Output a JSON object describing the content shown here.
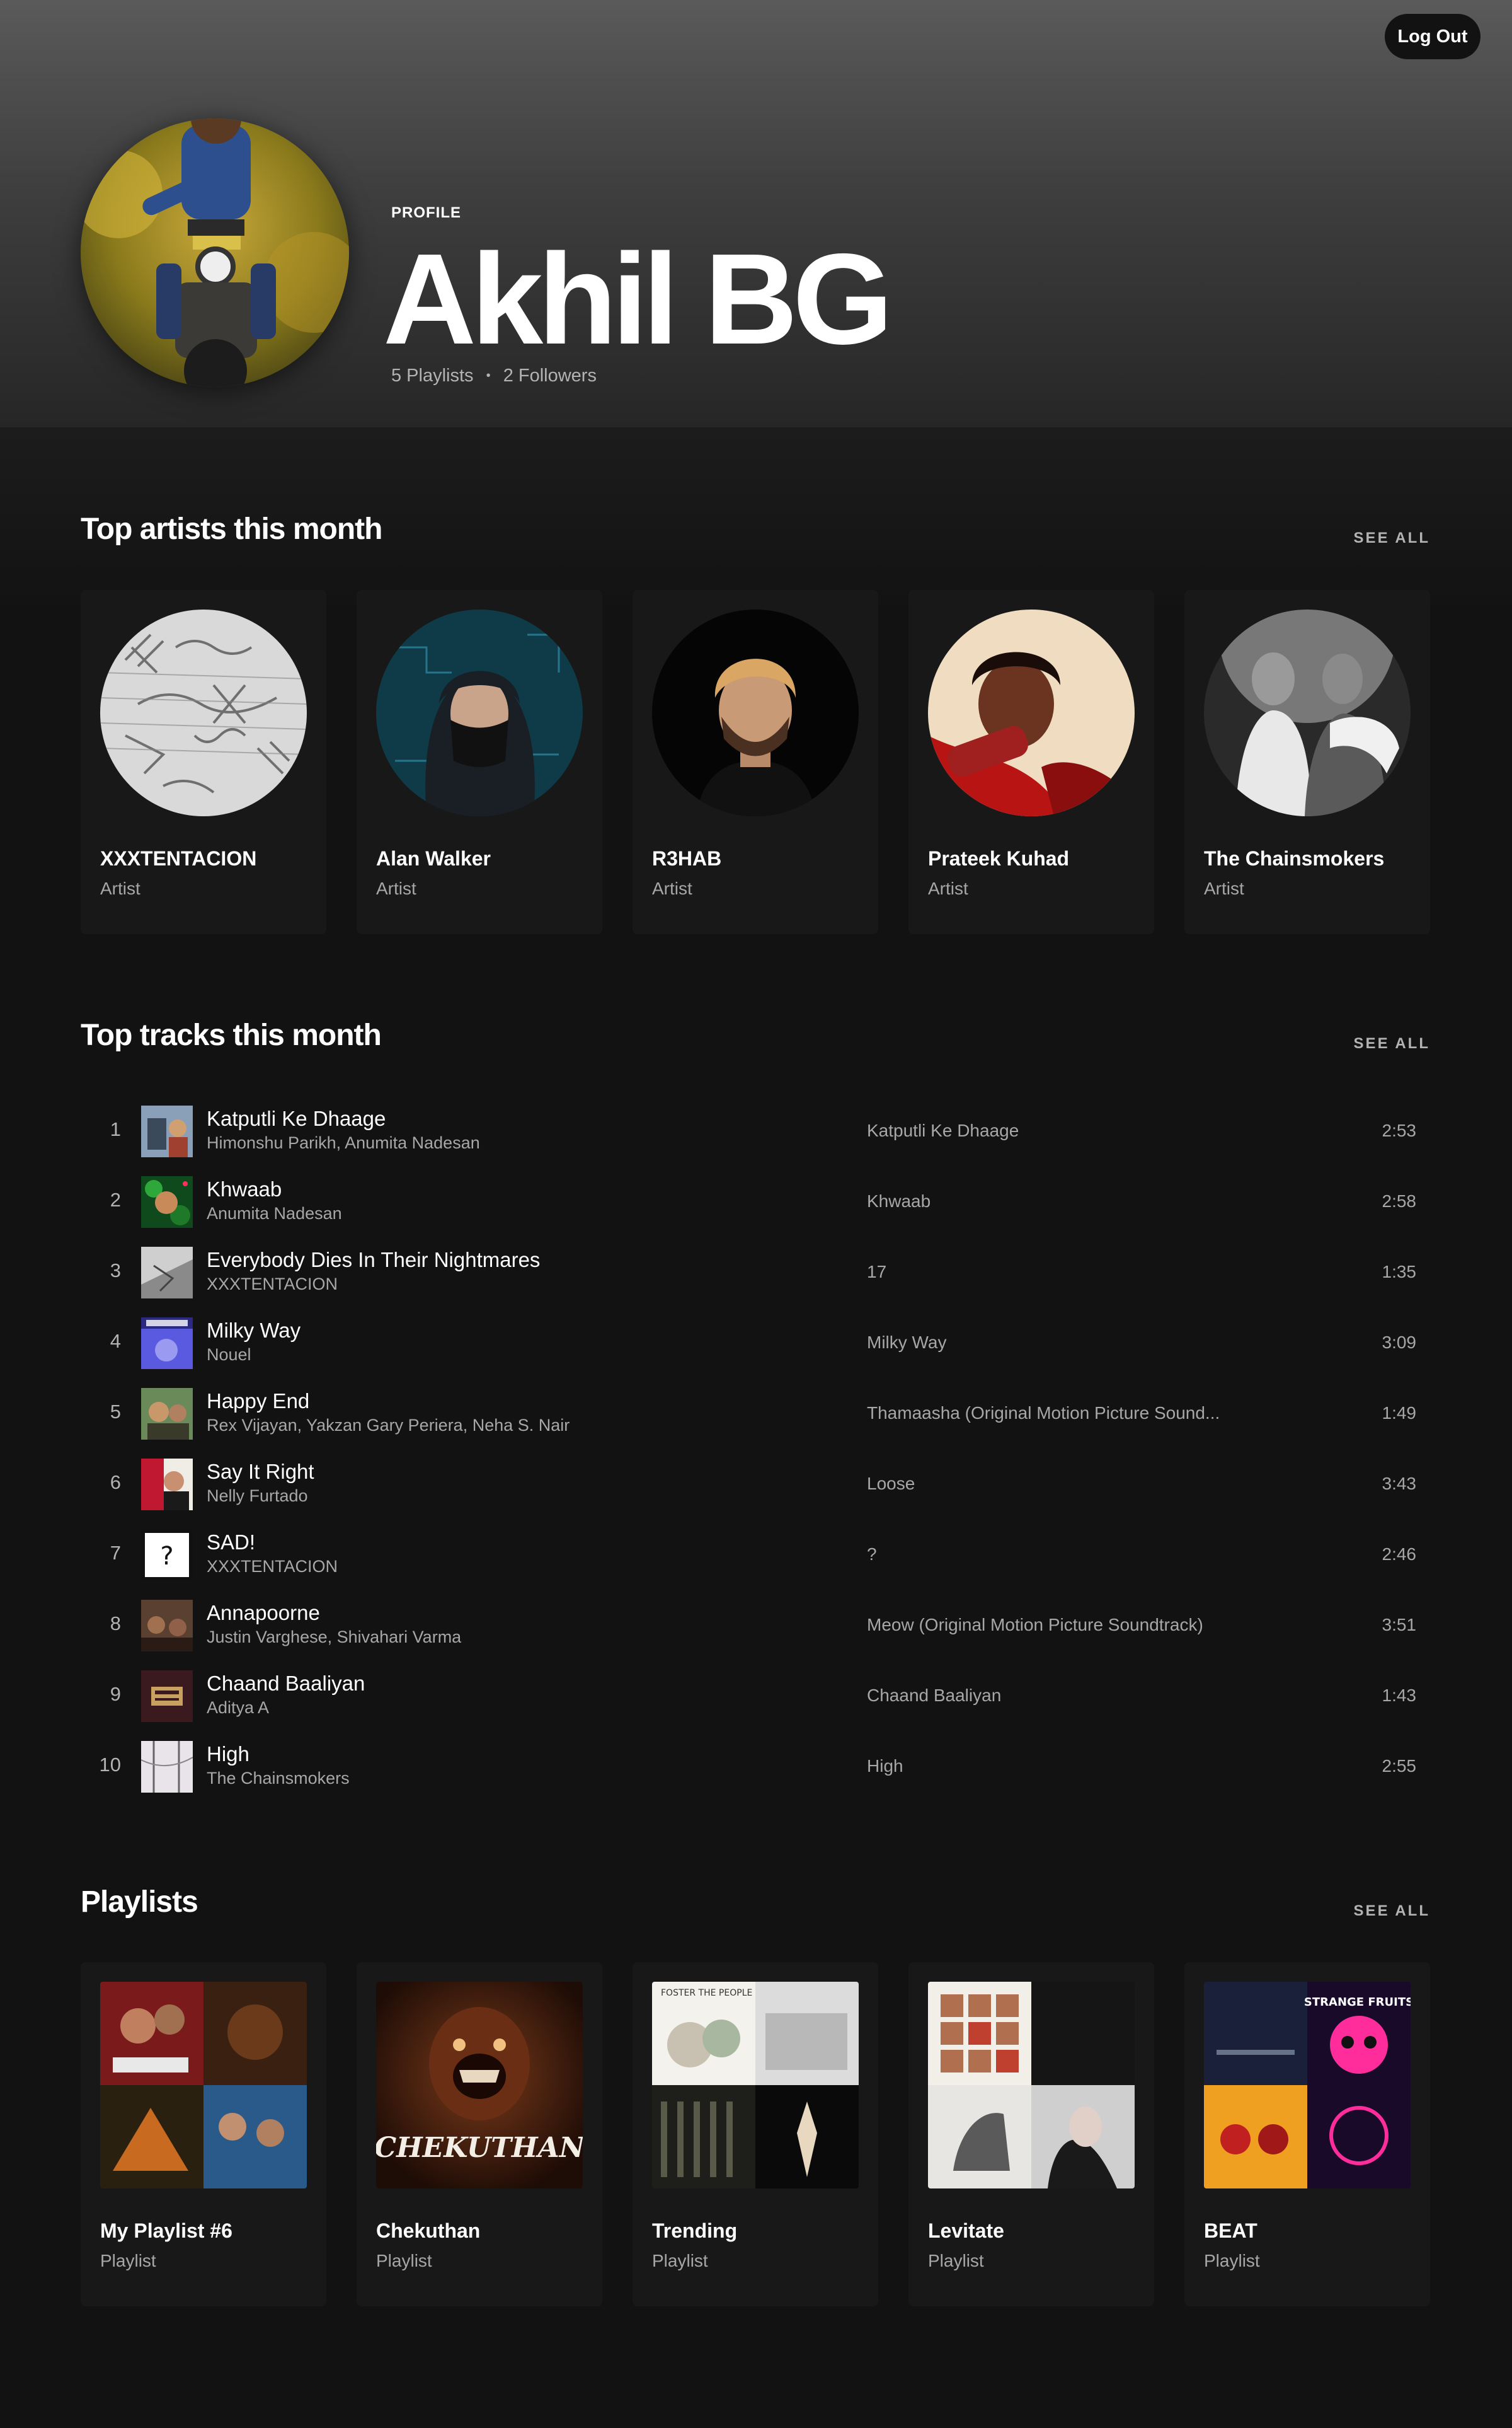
{
  "header": {
    "logout_label": "Log Out",
    "profile_label": "PROFILE",
    "name": "Akhil BG",
    "playlists": "5 Playlists",
    "separator": "•",
    "followers": "2 Followers"
  },
  "top_artists": {
    "title": "Top artists this month",
    "see_all": "SEE ALL",
    "items": [
      {
        "name": "XXXTENTACION",
        "type": "Artist"
      },
      {
        "name": "Alan Walker",
        "type": "Artist"
      },
      {
        "name": "R3HAB",
        "type": "Artist"
      },
      {
        "name": "Prateek Kuhad",
        "type": "Artist"
      },
      {
        "name": "The Chainsmokers",
        "type": "Artist"
      }
    ]
  },
  "top_tracks": {
    "title": "Top tracks this month",
    "see_all": "SEE ALL",
    "items": [
      {
        "num": "1",
        "title": "Katputli Ke Dhaage",
        "artist": "Himonshu Parikh, Anumita Nadesan",
        "album": "Katputli Ke Dhaage",
        "duration": "2:53"
      },
      {
        "num": "2",
        "title": "Khwaab",
        "artist": "Anumita Nadesan",
        "album": "Khwaab",
        "duration": "2:58"
      },
      {
        "num": "3",
        "title": "Everybody Dies In Their Nightmares",
        "artist": "XXXTENTACION",
        "album": "17",
        "duration": "1:35"
      },
      {
        "num": "4",
        "title": "Milky Way",
        "artist": "Nouel",
        "album": "Milky Way",
        "duration": "3:09"
      },
      {
        "num": "5",
        "title": "Happy End",
        "artist": "Rex Vijayan, Yakzan Gary Periera, Neha S. Nair",
        "album": "Thamaasha (Original Motion Picture Sound...",
        "duration": "1:49"
      },
      {
        "num": "6",
        "title": "Say It Right",
        "artist": "Nelly Furtado",
        "album": "Loose",
        "duration": "3:43"
      },
      {
        "num": "7",
        "title": "SAD!",
        "artist": "XXXTENTACION",
        "album": "?",
        "duration": "2:46"
      },
      {
        "num": "8",
        "title": "Annapoorne",
        "artist": "Justin Varghese, Shivahari Varma",
        "album": "Meow (Original Motion Picture Soundtrack)",
        "duration": "3:51"
      },
      {
        "num": "9",
        "title": "Chaand Baaliyan",
        "artist": "Aditya A",
        "album": "Chaand Baaliyan",
        "duration": "1:43"
      },
      {
        "num": "10",
        "title": "High",
        "artist": "The Chainsmokers",
        "album": "High",
        "duration": "2:55"
      }
    ]
  },
  "playlists": {
    "title": "Playlists",
    "see_all": "SEE ALL",
    "items": [
      {
        "name": "My Playlist #6",
        "type": "Playlist"
      },
      {
        "name": "Chekuthan",
        "type": "Playlist",
        "art_text": "CHEKUTHAN"
      },
      {
        "name": "Trending",
        "type": "Playlist",
        "art_text": "FOSTER THE PEOPLE"
      },
      {
        "name": "Levitate",
        "type": "Playlist"
      },
      {
        "name": "BEAT",
        "type": "Playlist",
        "art_text": "STRANGE FRUITS"
      }
    ]
  },
  "colors": {
    "background": "#121212",
    "card": "#181818",
    "text_secondary": "#a7a7a7",
    "accent_pink": "#ff2d9b"
  }
}
